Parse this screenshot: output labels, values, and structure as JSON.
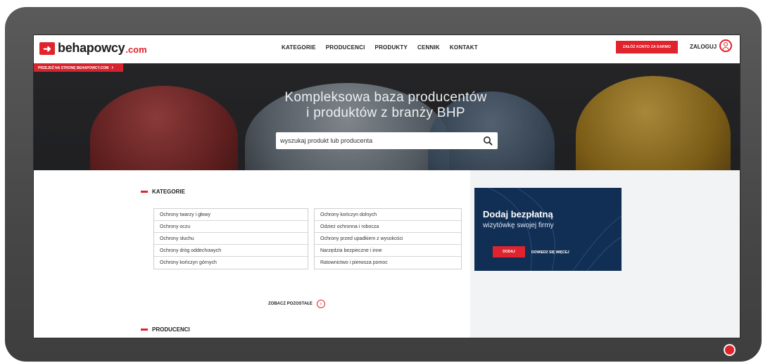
{
  "header": {
    "logo_brand": "behapowcy",
    "logo_tld": ".com",
    "nav": [
      "KATEGORIE",
      "PRODUCENCI",
      "PRODUKTY",
      "CENNIK",
      "KONTAKT"
    ],
    "cta": "ZAŁÓŻ KONTO ZA DARMO",
    "login": "ZALOGUJ"
  },
  "hero": {
    "ribbon": "PRZEJDŹ NA STRONĘ BEHAPOWCY.COM",
    "title_line1": "Kompleksowa baza producentów",
    "title_line2": "i produktów z branży BHP",
    "search_placeholder": "wyszukaj produkt lub producenta"
  },
  "categories": {
    "title": "KATEGORIE",
    "left": [
      "Ochrony twarzy i głowy",
      "Ochrony oczu",
      "Ochrony słuchu",
      "Ochrony dróg oddechowych",
      "Ochrony kończyn górnych"
    ],
    "right": [
      "Ochrony kończyn dolnych",
      "Odzież ochronna i robocza",
      "Ochrony przed upadkiem z wysokości",
      "Narzędzia bezpieczne i inne",
      "Ratownictwo i pierwsza pomoc"
    ],
    "see_more": "ZOBACZ POZOSTAŁE"
  },
  "producers": {
    "title": "PRODUCENCI"
  },
  "promo": {
    "title": "Dodaj bezpłatną",
    "subtitle": "wizytówkę swojej firmy",
    "add": "DODAJ",
    "more": "DOWIEDZ SIĘ WIĘCEJ"
  },
  "colors": {
    "accent": "#e0232d",
    "promo_bg": "#112f55",
    "hero_bg": "#26272b"
  },
  "icons": [
    "logo-arrow-icon",
    "user-icon",
    "search-icon",
    "chevron-right-icon",
    "arrow-circle-icon"
  ]
}
